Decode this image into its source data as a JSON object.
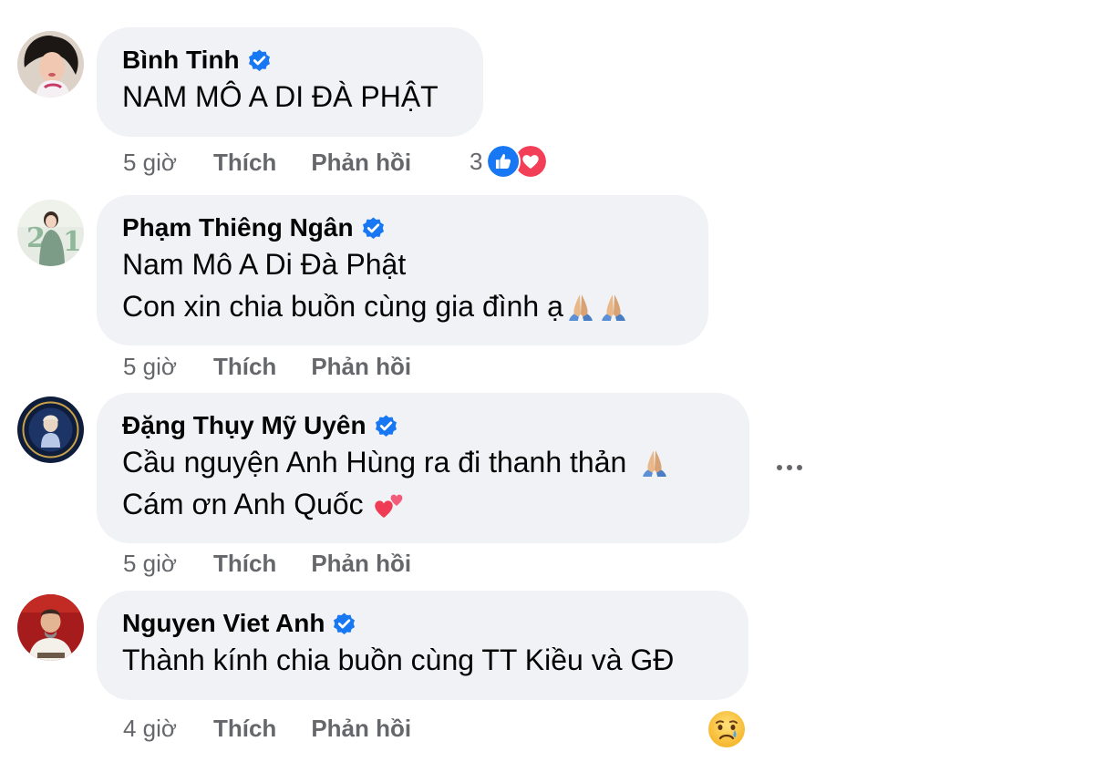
{
  "comments": [
    {
      "author": "Bình Tinh",
      "lines": [
        "NAM MÔ A DI ĐÀ PHẬT"
      ],
      "time": "5 giờ",
      "like_label": "Thích",
      "reply_label": "Phản hồi",
      "reaction_count": "3"
    },
    {
      "author": "Phạm Thiêng Ngân",
      "lines": [
        "Nam Mô A Di Đà Phật",
        "Con xin chia buồn cùng gia đình ạ"
      ],
      "time": "5 giờ",
      "like_label": "Thích",
      "reply_label": "Phản hồi"
    },
    {
      "author": "Đặng Thụy Mỹ Uyên",
      "lines": [
        "Cầu nguyện Anh Hùng ra đi thanh thản",
        "Cám ơn Anh Quốc"
      ],
      "time": "5 giờ",
      "like_label": "Thích",
      "reply_label": "Phản hồi"
    },
    {
      "author": "Nguyen Viet Anh",
      "lines": [
        "Thành kính chia buồn cùng TT Kiều và GĐ"
      ],
      "time": "4 giờ",
      "like_label": "Thích",
      "reply_label": "Phản hồi"
    }
  ],
  "icons": {
    "verified": "verified-badge-icon",
    "like_reaction": "like-reaction-icon",
    "love_reaction": "love-reaction-icon",
    "pray_emoji": "folded-hands-emoji",
    "hearts_emoji": "two-hearts-emoji",
    "sad_emoji": "crying-face-emoji",
    "more": "more-options-icon"
  },
  "colors": {
    "bubble": "#f0f2f5",
    "meta_text": "#65676b",
    "verified": "#1877f2",
    "like": "#1877f2",
    "love": "#f33e58"
  }
}
